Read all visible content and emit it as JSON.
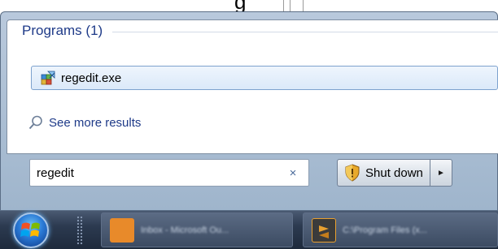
{
  "background": {
    "doc_text": "g"
  },
  "start_menu": {
    "group_title": "Programs (1)",
    "results": [
      {
        "label": "regedit.exe",
        "icon": "regedit-icon"
      }
    ],
    "see_more": {
      "label": "See more results",
      "icon": "magnifier-icon"
    },
    "search": {
      "value": "regedit",
      "clear_glyph": "×"
    },
    "shutdown": {
      "label": "Shut down",
      "icon": "uac-shield-icon",
      "arrow": "►"
    }
  },
  "taskbar": {
    "start_icon": "windows-orb-icon",
    "buttons": [
      {
        "icon": "outlook-icon",
        "text": "Inbox - Microsoft Ou...",
        "color": "#e88a2a"
      },
      {
        "icon": "sublime-icon",
        "text": "C:\\Program Files (x...",
        "color": "#e8a030"
      }
    ]
  },
  "colors": {
    "menu_frame": "#b9c9dc",
    "group_title": "#1e3a88",
    "selected_item_border": "#7da2ce",
    "taskbar": "#2c3a50"
  }
}
